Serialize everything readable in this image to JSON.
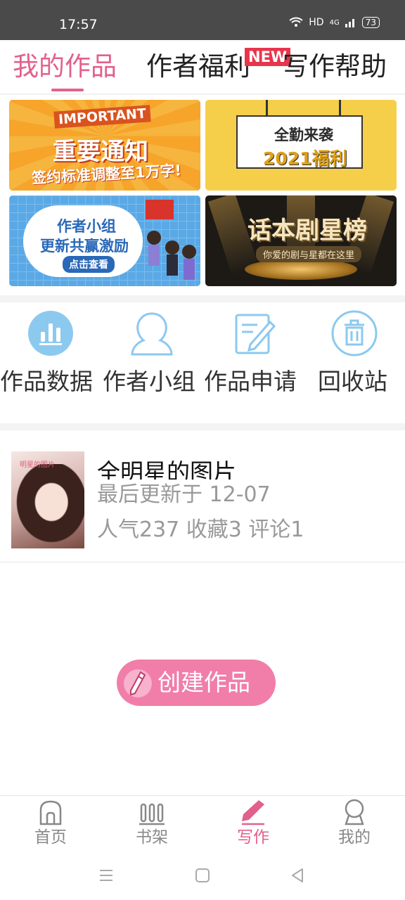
{
  "status_bar": {
    "time": "17:57",
    "network": "HD",
    "signal": "4G",
    "battery": "73"
  },
  "top_tabs": [
    {
      "label": "我的作品",
      "active": true
    },
    {
      "label": "作者福利",
      "active": false,
      "badge": "NEW"
    },
    {
      "label": "写作帮助",
      "active": false
    }
  ],
  "banners": [
    {
      "label": "IMPORTANT",
      "title": "重要通知",
      "subtitle": "签约标准调整至1万字!"
    },
    {
      "title": "全勤来袭",
      "subtitle": "2021福利"
    },
    {
      "title": "作者小组",
      "subtitle": "更新共赢激励",
      "button": "点击查看"
    },
    {
      "title": "话本剧星榜",
      "subtitle": "你爱的剧与星都在这里"
    }
  ],
  "functions": [
    {
      "label": "作品数据",
      "icon": "bar-chart-icon"
    },
    {
      "label": "作者小组",
      "icon": "person-group-icon"
    },
    {
      "label": "作品申请",
      "icon": "edit-document-icon"
    },
    {
      "label": "回收站",
      "icon": "trash-icon"
    }
  ],
  "works": [
    {
      "title": "全明星的图片",
      "updated": "最后更新于 12-07",
      "stats": "人气237 收藏3 评论1",
      "cover_caption": "明星的图片"
    }
  ],
  "create_button": {
    "label": "创建作品",
    "icon": "pencil-icon"
  },
  "bottom_nav": [
    {
      "label": "首页",
      "icon": "home-icon",
      "active": false
    },
    {
      "label": "书架",
      "icon": "bookshelf-icon",
      "active": false
    },
    {
      "label": "写作",
      "icon": "pen-icon",
      "active": true
    },
    {
      "label": "我的",
      "icon": "profile-icon",
      "active": false
    }
  ],
  "colors": {
    "accent": "#e3608c",
    "create_button": "#f07ea9",
    "icon_blue": "#8cc9ef"
  }
}
